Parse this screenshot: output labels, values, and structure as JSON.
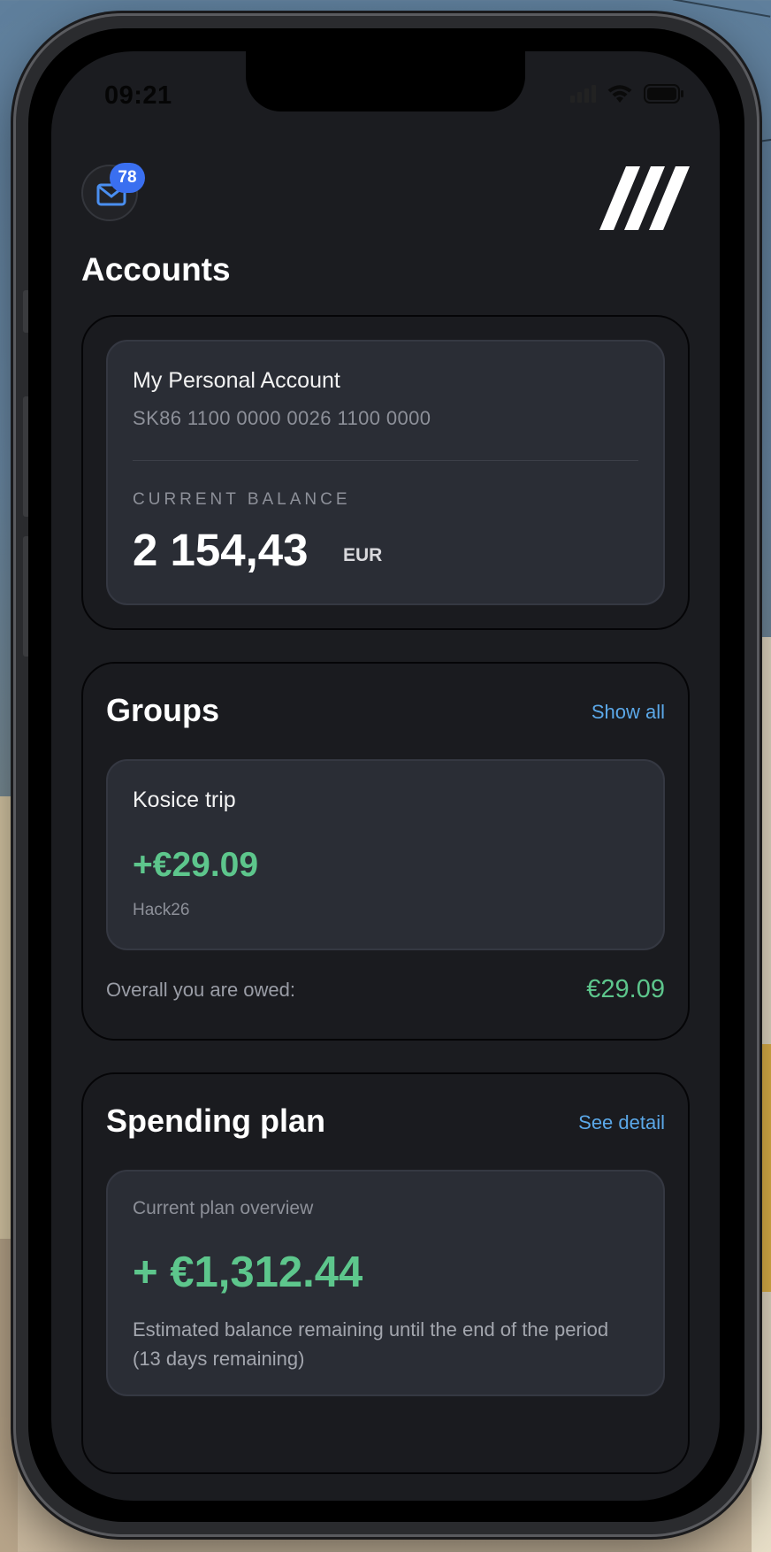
{
  "status_bar": {
    "time": "09:21"
  },
  "header": {
    "mail_icon": "mail-icon",
    "unread_count": "78",
    "logo_icon": "brand-slashes-logo"
  },
  "accounts": {
    "title": "Accounts",
    "card": {
      "name": "My Personal Account",
      "iban": "SK86 1100 0000 0026 1100 0000",
      "balance_label": "CURRENT BALANCE",
      "balance_amount": "2 154,43",
      "currency": "EUR"
    }
  },
  "groups": {
    "title": "Groups",
    "link": "Show all",
    "items": [
      {
        "name": "Kosice trip",
        "amount": "+€29.09",
        "subtitle": "Hack26"
      }
    ],
    "owed_label": "Overall you are owed:",
    "owed_value": "€29.09"
  },
  "spending_plan": {
    "title": "Spending plan",
    "link": "See detail",
    "overview_label": "Current plan overview",
    "amount": "+ €1,312.44",
    "description": "Estimated balance remaining until the end of the period (13 days remaining)"
  },
  "colors": {
    "accent_link": "#5ba8e8",
    "positive": "#5dc68c",
    "badge": "#3a6ff0",
    "background": "#1b1c20",
    "card_inner": "#2a2d35"
  }
}
